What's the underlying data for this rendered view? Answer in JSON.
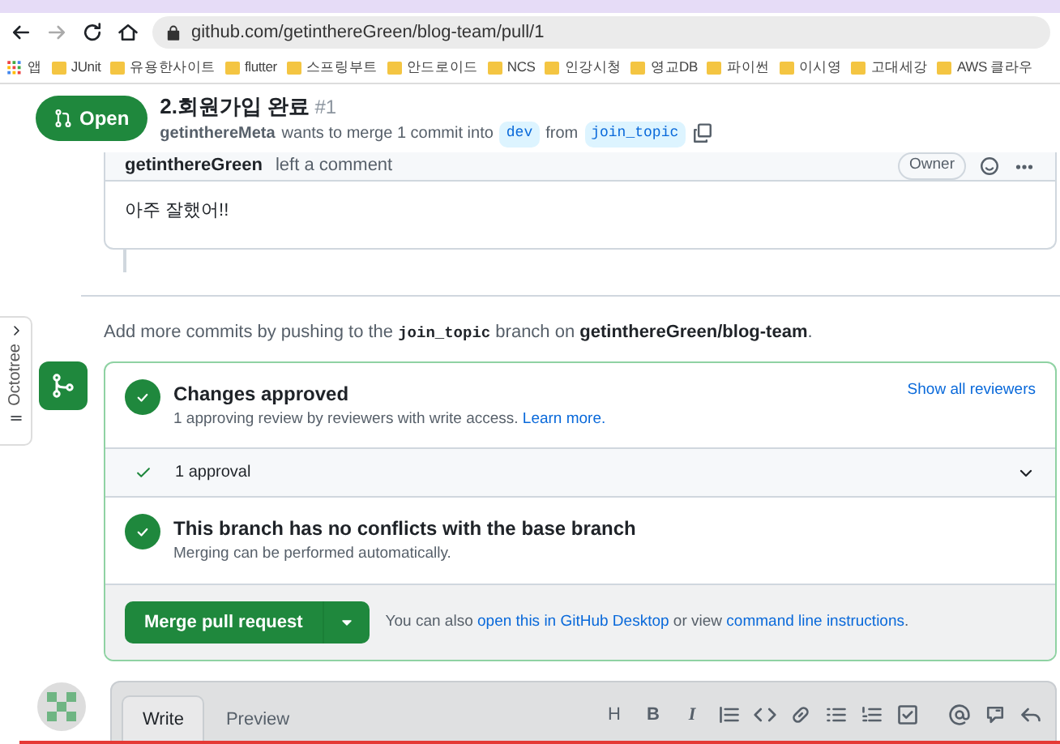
{
  "browser": {
    "url": "github.com/getinthereGreen/blog-team/pull/1",
    "bookmarks": [
      "앱",
      "JUnit",
      "유용한사이트",
      "flutter",
      "스프링부트",
      "안드로이드",
      "NCS",
      "인강시청",
      "영교DB",
      "파이썬",
      "이시영",
      "고대세강",
      "AWS 클라우"
    ]
  },
  "pr_header": {
    "state": "Open",
    "title": "2.회원가입 완료",
    "number": "#1",
    "author": "getinthereMeta",
    "summary": "wants to merge 1 commit into",
    "base": "dev",
    "from": "from",
    "head": "join_topic"
  },
  "comment": {
    "author": "getinthereGreen",
    "action": "left a comment",
    "badge": "Owner",
    "body": "아주 잘했어!!"
  },
  "push_hint": {
    "text": "Add more commits by pushing to the",
    "branch": "join_topic",
    "middle": "branch on",
    "repo": "getinthereGreen/blog-team",
    "end": "."
  },
  "octotree": {
    "label": "Octotree"
  },
  "merge_box": {
    "sections": [
      {
        "kind": "status",
        "title": "Changes approved",
        "detail": "1 approving review by reviewers with write access.",
        "link": "Learn more.",
        "action": "Show all reviewers"
      },
      {
        "kind": "toggle",
        "label": "1 approval",
        "expanded": false
      },
      {
        "kind": "status",
        "title": "This branch has no conflicts with the base branch",
        "detail": "Merging can be performed automatically."
      }
    ],
    "merge_button": "Merge pull request",
    "hint": "You can also",
    "hint_link1": "open this in GitHub Desktop",
    "hint_mid": "or view",
    "hint_link2": "command line instructions",
    "hint_end": "."
  },
  "editor": {
    "tabs": [
      {
        "label": "Write",
        "selected": true
      },
      {
        "label": "Preview",
        "selected": false
      }
    ],
    "toolbar": [
      {
        "kind": "text",
        "label": "H"
      },
      {
        "kind": "text",
        "label": "B"
      },
      {
        "kind": "text",
        "label": "I"
      },
      {
        "kind": "quote"
      },
      {
        "kind": "code"
      },
      {
        "kind": "link"
      },
      {
        "kind": "ul"
      },
      {
        "kind": "ol"
      },
      {
        "kind": "task"
      },
      {
        "kind": "mention"
      },
      {
        "kind": "reference"
      },
      {
        "kind": "reply"
      }
    ]
  }
}
